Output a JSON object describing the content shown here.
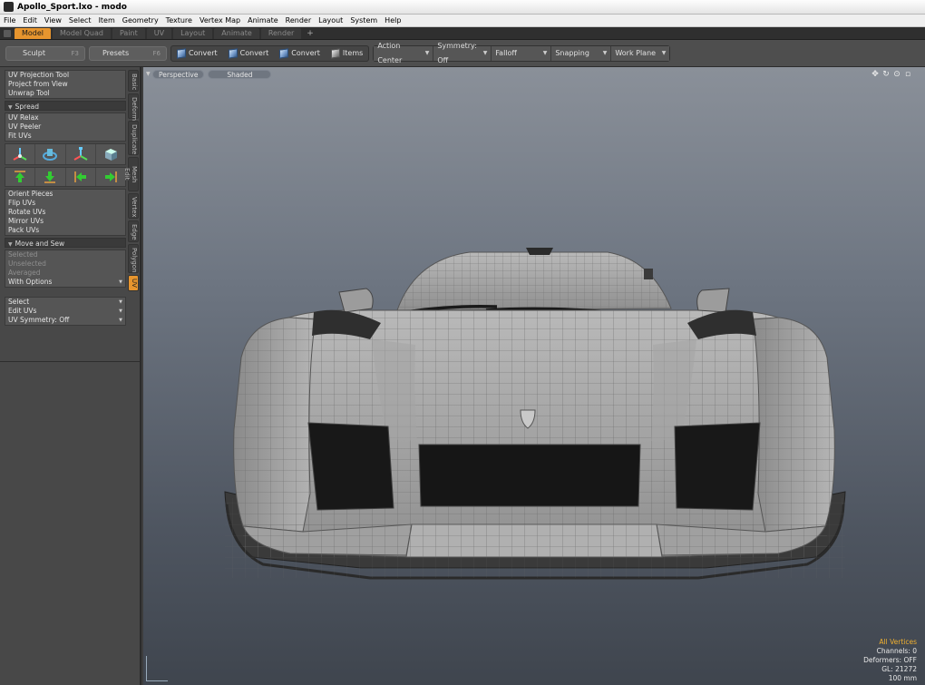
{
  "window": {
    "title": "Apollo_Sport.lxo - modo"
  },
  "menu": [
    "File",
    "Edit",
    "View",
    "Select",
    "Item",
    "Geometry",
    "Texture",
    "Vertex Map",
    "Animate",
    "Render",
    "Layout",
    "System",
    "Help"
  ],
  "layout_tabs": [
    {
      "label": "Model",
      "active": true
    },
    {
      "label": "Model Quad",
      "active": false
    },
    {
      "label": "Paint",
      "active": false
    },
    {
      "label": "UV",
      "active": false
    },
    {
      "label": "Layout",
      "active": false
    },
    {
      "label": "Animate",
      "active": false
    },
    {
      "label": "Render",
      "active": false
    }
  ],
  "layout_tab_add": "+",
  "toolbar": {
    "sculpt": "Sculpt",
    "sculpt_key": "F3",
    "presets": "Presets",
    "presets_key": "F6",
    "convert1": "Convert",
    "convert2": "Convert",
    "convert3": "Convert",
    "items": "Items",
    "action_center": "Action Center",
    "symmetry": "Symmetry: Off",
    "falloff": "Falloff",
    "snapping": "Snapping",
    "work_plane": "Work Plane"
  },
  "left_panel": {
    "projection": [
      "UV Projection Tool",
      "Project from View",
      "Unwrap Tool"
    ],
    "spread_header": "Spread",
    "relax": [
      "UV Relax",
      "UV Peeler",
      "Fit UVs"
    ],
    "orient": [
      "Orient Pieces",
      "Flip UVs",
      "Rotate UVs",
      "Mirror UVs",
      "Pack UVs"
    ],
    "move_sew_header": "Move and Sew",
    "sew_options": [
      "Selected",
      "Unselected",
      "Averaged"
    ],
    "with_options": "With Options",
    "dropdowns": [
      "Select",
      "Edit UVs",
      "UV Symmetry: Off"
    ]
  },
  "side_tabs": [
    {
      "label": "Basic",
      "active": false
    },
    {
      "label": "Deform",
      "active": false
    },
    {
      "label": "Duplicate",
      "active": false
    },
    {
      "label": "Mesh Edit",
      "active": false
    },
    {
      "label": "Vertex",
      "active": false
    },
    {
      "label": "Edge",
      "active": false
    },
    {
      "label": "Polygon",
      "active": false
    },
    {
      "label": "UV",
      "active": true
    }
  ],
  "viewport": {
    "view_mode": "Perspective",
    "shading": "Shaded",
    "info": {
      "selection": "All Vertices",
      "channels": "Channels: 0",
      "deformers": "Deformers: OFF",
      "gl": "GL: 21272",
      "scale": "100 mm"
    }
  },
  "colors": {
    "accent": "#e7952e",
    "panel": "#484848",
    "viewport_top": "#8a9099",
    "viewport_bottom": "#3f454e"
  }
}
